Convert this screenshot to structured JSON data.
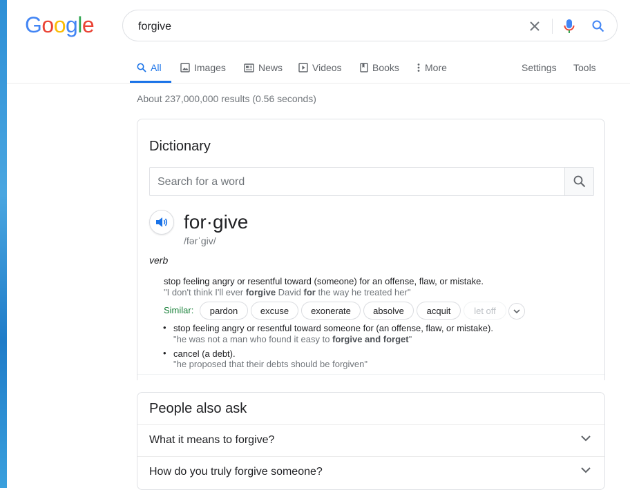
{
  "logo": {
    "letters": [
      "G",
      "o",
      "o",
      "g",
      "l",
      "e"
    ]
  },
  "search": {
    "query": "forgive"
  },
  "tabs": [
    {
      "label": "All",
      "icon": "search-icon"
    },
    {
      "label": "Images",
      "icon": "image-icon"
    },
    {
      "label": "News",
      "icon": "news-icon"
    },
    {
      "label": "Videos",
      "icon": "video-icon"
    },
    {
      "label": "Books",
      "icon": "book-icon"
    },
    {
      "label": "More",
      "icon": "more-vert-icon"
    }
  ],
  "tools": {
    "settings": "Settings",
    "tools": "Tools"
  },
  "result_stats": "About 237,000,000 results (0.56 seconds)",
  "dictionary": {
    "title": "Dictionary",
    "search_placeholder": "Search for a word",
    "headword": "for·give",
    "phonetic": "/fərˈɡiv/",
    "part_of_speech": "verb",
    "definition_1": "stop feeling angry or resentful toward (someone) for an offense, flaw, or mistake.",
    "example_1": {
      "pre": "\"I don't think I'll ever ",
      "bold1": "forgive",
      "mid": " David ",
      "bold2": "for",
      "post": " the way he treated her\""
    },
    "similar_label": "Similar:",
    "similar": [
      "pardon",
      "excuse",
      "exonerate",
      "absolve",
      "acquit",
      "let off"
    ],
    "definition_2": "stop feeling angry or resentful toward someone for (an offense, flaw, or mistake).",
    "example_2": {
      "pre": "\"he was not a man who found it easy to ",
      "bold": "forgive and forget",
      "post": "\""
    },
    "definition_3": "cancel (a debt).",
    "example_3": "\"he proposed that their debts should be forgiven\""
  },
  "paa": {
    "title": "People also ask",
    "questions": [
      "What it means to forgive?",
      "How do you truly forgive someone?"
    ]
  },
  "colors": {
    "accent": "#1a73e8",
    "similar_label": "#188038"
  }
}
